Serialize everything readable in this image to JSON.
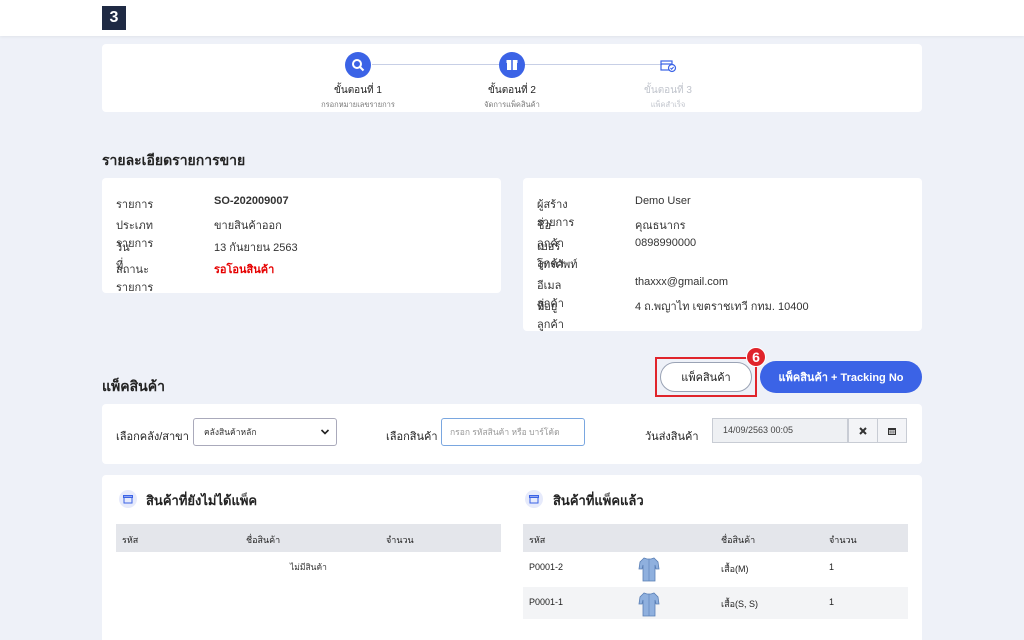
{
  "app": {
    "logo_text": "3"
  },
  "steps": [
    {
      "title": "ขั้นตอนที่ 1",
      "subtitle": "กรอกหมายเลขรายการ",
      "icon": "search-icon",
      "active": true
    },
    {
      "title": "ขั้นตอนที่ 2",
      "subtitle": "จัดการแพ็คสินค้า",
      "icon": "box-icon",
      "active": true
    },
    {
      "title": "ขั้นตอนที่ 3",
      "subtitle": "แพ็คสำเร็จ",
      "icon": "box-check-icon",
      "active": false
    }
  ],
  "details": {
    "title": "รายละเอียดรายการขาย",
    "left": [
      {
        "label": "รายการ",
        "value": "SO-202009007"
      },
      {
        "label": "ประเภทรายการ",
        "value": "ขายสินค้าออก"
      },
      {
        "label": "วันที่",
        "value": "13 กันยายน 2563"
      },
      {
        "label": "สถานะรายการ",
        "value": "รอโอนสินค้า"
      }
    ],
    "right": [
      {
        "label": "ผู้สร้างรายการ",
        "value": "Demo User"
      },
      {
        "label": "ชื่อลูกค้า",
        "value": "คุณธนากร"
      },
      {
        "label": "เบอร์โทรศัพท์",
        "label2": "ลูกค้า",
        "value": "0898990000"
      },
      {
        "label": "อีเมลลูกค้า",
        "value": "thaxxx@gmail.com"
      },
      {
        "label": "ที่อยู่ลูกค้า",
        "value": "4 ถ.พญาไท เขตราชเทวี กทม. 10400"
      }
    ]
  },
  "pack": {
    "title": "แพ็คสินค้า",
    "pack_button": "แพ็คสินค้า",
    "pack_tracking_button": "แพ็คสินค้า + Tracking No",
    "badge": "6",
    "warehouse_label": "เลือกคลัง/สาขา",
    "warehouse_value": "คลังสินค้าหลัก",
    "product_label": "เลือกสินค้า",
    "product_placeholder": "กรอก รหัสสินค้า หรือ บาร์โค้ด",
    "ship_date_label": "วันส่งสินค้า",
    "ship_date_value": "14/09/2563 00:05"
  },
  "unpacked": {
    "title": "สินค้าที่ยังไม่ได้แพ็ค",
    "columns": [
      "รหัส",
      "ชื่อสินค้า",
      "จำนวน"
    ],
    "empty_message": "ไม่มีสินค้า"
  },
  "packed": {
    "title": "สินค้าที่แพ็คแล้ว",
    "columns": [
      "รหัส",
      "ชื่อสินค้า",
      "จำนวน"
    ],
    "rows": [
      {
        "code": "P0001-2",
        "name": "เสื้อ(M)",
        "qty": "1"
      },
      {
        "code": "P0001-1",
        "name": "เสื้อ(S, S)",
        "qty": "1"
      }
    ]
  },
  "colors": {
    "primary": "#3b63e6",
    "danger": "#e60000",
    "highlight": "#e0242b"
  }
}
